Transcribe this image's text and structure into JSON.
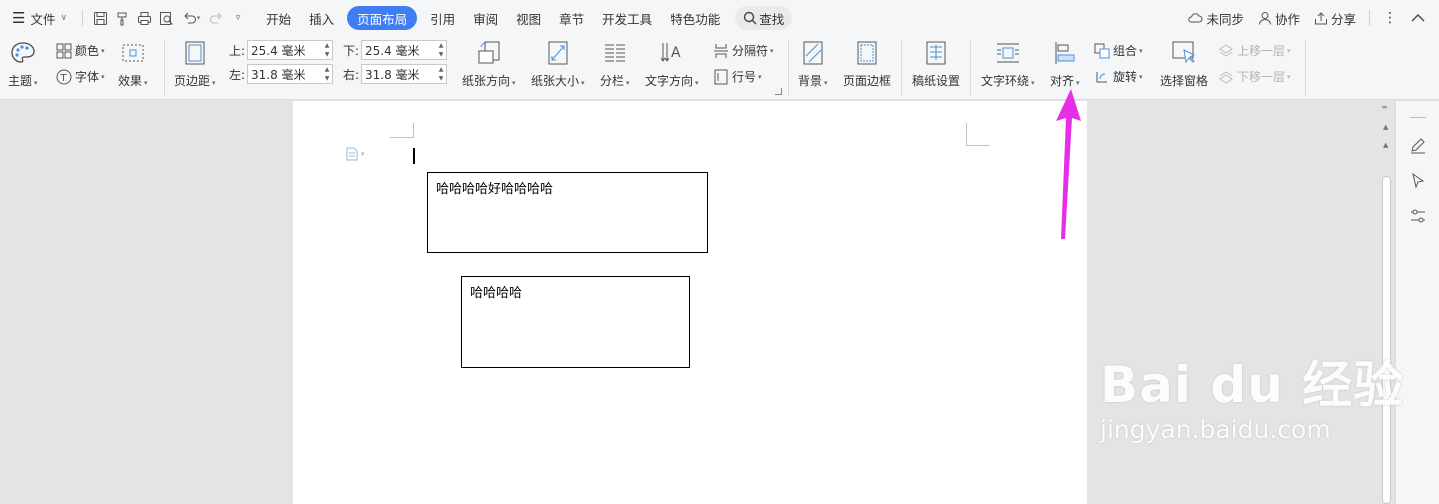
{
  "menubar": {
    "file": "文件",
    "tabs": [
      "开始",
      "插入",
      "页面布局",
      "引用",
      "审阅",
      "视图",
      "章节",
      "开发工具",
      "特色功能"
    ],
    "active_tab": "页面布局",
    "search": "查找",
    "sync": "未同步",
    "collab": "协作",
    "share": "分享"
  },
  "ribbon": {
    "theme": "主题",
    "color": "颜色",
    "font": "字体",
    "effect": "效果",
    "margins": "页边距",
    "margin_top_label": "上:",
    "margin_top": "25.4 毫米",
    "margin_bottom_label": "下:",
    "margin_bottom": "25.4 毫米",
    "margin_left_label": "左:",
    "margin_left": "31.8 毫米",
    "margin_right_label": "右:",
    "margin_right": "31.8 毫米",
    "orientation": "纸张方向",
    "paper_size": "纸张大小",
    "columns": "分栏",
    "text_direction": "文字方向",
    "separator": "分隔符",
    "line_number": "行号",
    "background": "背景",
    "page_border": "页面边框",
    "manuscript": "稿纸设置",
    "text_wrap": "文字环绕",
    "align": "对齐",
    "group": "组合",
    "rotate": "旋转",
    "selection_pane": "选择窗格",
    "bring_forward": "上移一层",
    "send_backward": "下移一层"
  },
  "document": {
    "textbox1": "哈哈哈哈好哈哈哈哈",
    "textbox2": "哈哈哈哈"
  },
  "watermark": {
    "logo": "Bai du 经验",
    "url": "jingyan.baidu.com"
  },
  "colors": {
    "accent": "#3f7ef2",
    "arrow": "#e62ee6"
  }
}
